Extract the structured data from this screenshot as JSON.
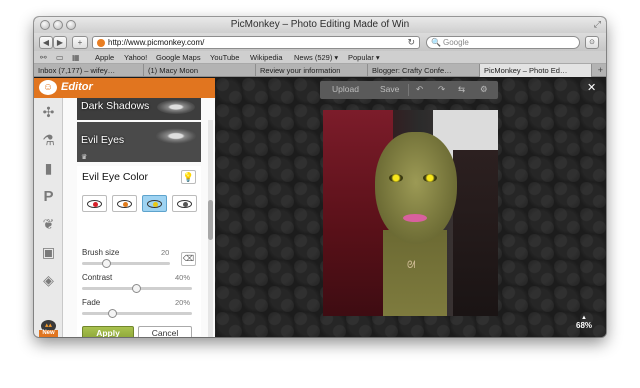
{
  "window": {
    "title": "PicMonkey – Photo Editing Made of Win"
  },
  "toolbar": {
    "url": "http://www.picmonkey.com/",
    "search_placeholder": "Google"
  },
  "bookmarks": [
    "Apple",
    "Yahoo!",
    "Google Maps",
    "YouTube",
    "Wikipedia",
    "News (529) ▾",
    "Popular ▾"
  ],
  "tabs": [
    {
      "label": "Inbox (7,177) – wifey…",
      "active": false
    },
    {
      "label": "(1) Macy Moon",
      "active": false
    },
    {
      "label": "Review your information",
      "active": false
    },
    {
      "label": "Blogger: Crafty Confe…",
      "active": false
    },
    {
      "label": "PicMonkey – Photo Ed…",
      "active": true
    }
  ],
  "editor": {
    "logo_text": "Editor",
    "effects": [
      {
        "label": "Dark Shadows"
      },
      {
        "label": "Evil Eyes"
      }
    ],
    "panel": {
      "title": "Evil Eye Color",
      "brush_size_label": "Brush size",
      "brush_size_value": "20",
      "contrast_label": "Contrast",
      "contrast_value": "40%",
      "fade_label": "Fade",
      "fade_value": "20%",
      "apply_label": "Apply",
      "cancel_label": "Cancel",
      "swatch_colors": [
        "#d6202a",
        "#e07a1a",
        "#e8c814",
        "#555555"
      ],
      "selected_swatch": 2,
      "brush_size_level": 0.28,
      "contrast_level": 0.5,
      "fade_level": 0.28
    },
    "new_badge": "New",
    "topbar": {
      "upload_label": "Upload",
      "save_label": "Save"
    },
    "zoom_label": "68%",
    "accent_color": "#e1751f",
    "apply_color": "#8aa336"
  }
}
